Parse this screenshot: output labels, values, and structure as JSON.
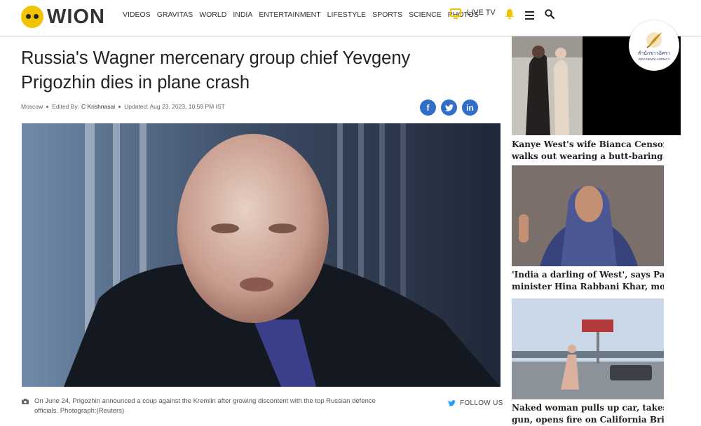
{
  "header": {
    "logo_text": "WION",
    "nav": [
      "VIDEOS",
      "GRAVITAS",
      "WORLD",
      "INDIA",
      "ENTERTAINMENT",
      "LIFESTYLE",
      "SPORTS",
      "SCIENCE",
      "PHOTOS"
    ],
    "live_tv": "LIVE TV",
    "icons": [
      "tv-icon",
      "bell-icon",
      "menu-icon",
      "search-icon"
    ]
  },
  "article": {
    "headline": "Russia's Wagner mercenary group chief Yevgeny Prigozhin dies in plane crash",
    "location": "Moscow",
    "edited_by_label": "Edited By:",
    "editor": "C Krishnasai",
    "updated": "Updated: Aug 23, 2023, 10:59 PM IST",
    "share": [
      "f",
      "t",
      "in"
    ],
    "caption": "On June 24, Prigozhin announced a coup against the Kremlin after growing discontent with the top Russian defence officials. Photograph:(Reuters)",
    "follow": "FOLLOW US"
  },
  "sidebar": {
    "items": [
      {
        "title_line1": "Kanye West's wife Bianca Censori",
        "title_line2": "walks out wearing a butt-baring..."
      },
      {
        "title_line1": "'India a darling of West', says Pak",
        "title_line2": "minister Hina Rabbani Khar, mock..."
      },
      {
        "title_line1": "Naked woman pulls up car, takes out",
        "title_line2": "gun, opens fire on California Bridge;"
      }
    ]
  },
  "badge": {
    "thai": "สำนักข่าวอิศรา",
    "en": "ISRA NEWS AGENCY"
  },
  "colors": {
    "accent": "#f2c300",
    "share_blue": "#2f6fc8",
    "twitter": "#1da1f2"
  }
}
